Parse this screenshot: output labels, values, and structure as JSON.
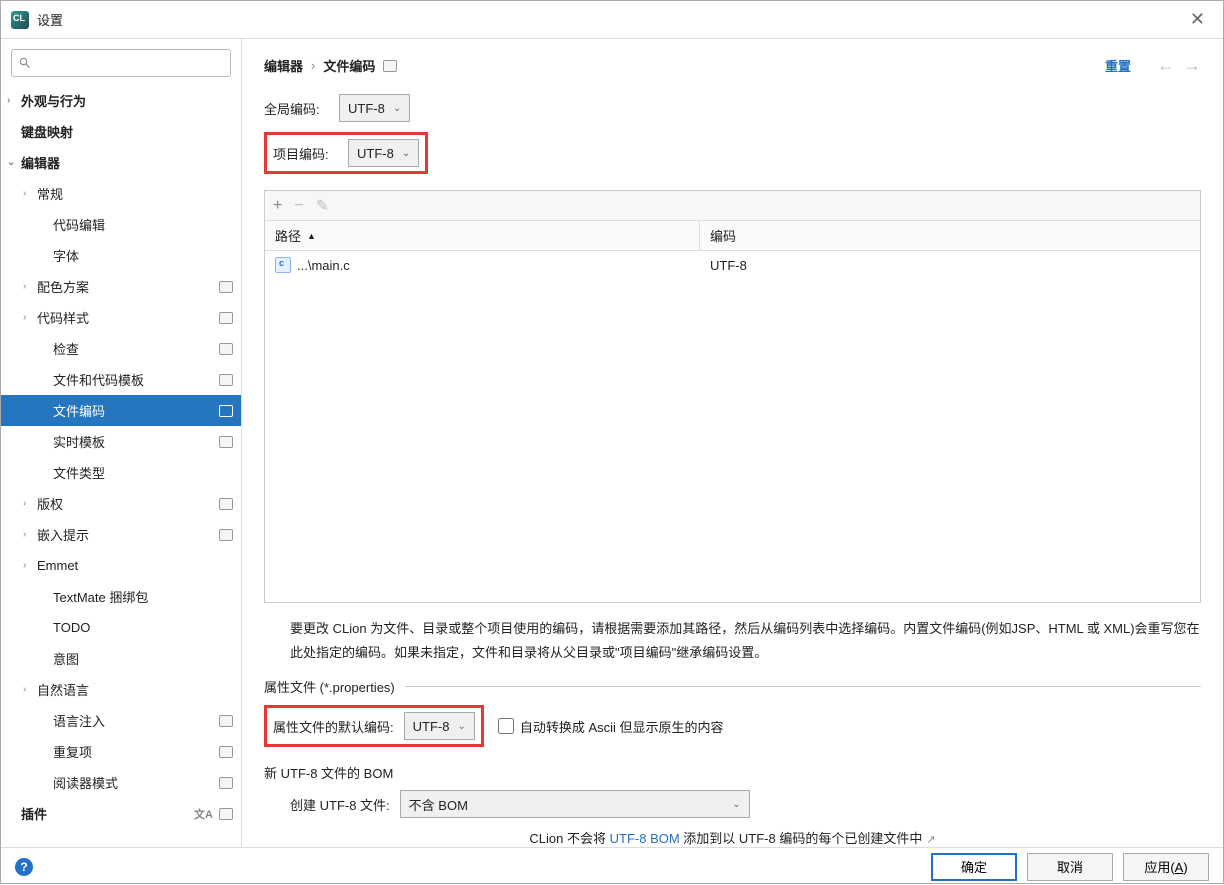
{
  "window": {
    "title": "设置"
  },
  "sidebar": {
    "search_placeholder": "",
    "items": [
      {
        "label": "外观与行为",
        "level": 0,
        "chev": "›",
        "bold": true
      },
      {
        "label": "键盘映射",
        "level": 0,
        "bold": true
      },
      {
        "label": "编辑器",
        "level": 0,
        "chev": "⌄",
        "bold": true
      },
      {
        "label": "常规",
        "level": 1,
        "chev": "›"
      },
      {
        "label": "代码编辑",
        "level": 2
      },
      {
        "label": "字体",
        "level": 2
      },
      {
        "label": "配色方案",
        "level": 1,
        "chev": "›",
        "badge": true
      },
      {
        "label": "代码样式",
        "level": 1,
        "chev": "›",
        "badge": true
      },
      {
        "label": "检查",
        "level": 2,
        "badge": true
      },
      {
        "label": "文件和代码模板",
        "level": 2,
        "badge": true
      },
      {
        "label": "文件编码",
        "level": 2,
        "badge": true,
        "selected": true
      },
      {
        "label": "实时模板",
        "level": 2,
        "badge": true
      },
      {
        "label": "文件类型",
        "level": 2
      },
      {
        "label": "版权",
        "level": 1,
        "chev": "›",
        "badge": true
      },
      {
        "label": "嵌入提示",
        "level": 1,
        "chev": "›",
        "badge": true
      },
      {
        "label": "Emmet",
        "level": 1,
        "chev": "›"
      },
      {
        "label": "TextMate 捆绑包",
        "level": 2
      },
      {
        "label": "TODO",
        "level": 2
      },
      {
        "label": "意图",
        "level": 2
      },
      {
        "label": "自然语言",
        "level": 1,
        "chev": "›"
      },
      {
        "label": "语言注入",
        "level": 2,
        "badge": true
      },
      {
        "label": "重复项",
        "level": 2,
        "badge": true
      },
      {
        "label": "阅读器模式",
        "level": 2,
        "badge": true
      },
      {
        "label": "插件",
        "level": 0,
        "bold": true,
        "lang": true,
        "badge": true
      }
    ]
  },
  "breadcrumb": {
    "root": "编辑器",
    "page": "文件编码",
    "reset": "重置"
  },
  "encoding": {
    "global_label": "全局编码:",
    "global_value": "UTF-8",
    "project_label": "项目编码:",
    "project_value": "UTF-8"
  },
  "table": {
    "col_path": "路径",
    "col_encoding": "编码",
    "rows": [
      {
        "path": "...\\main.c",
        "encoding": "UTF-8"
      }
    ]
  },
  "help_text": "要更改 CLion 为文件、目录或整个项目使用的编码，请根据需要添加其路径，然后从编码列表中选择编码。内置文件编码(例如JSP、HTML 或 XML)会重写您在此处指定的编码。如果未指定，文件和目录将从父目录或\"项目编码\"继承编码设置。",
  "properties": {
    "legend": "属性文件 (*.properties)",
    "default_label": "属性文件的默认编码:",
    "default_value": "UTF-8",
    "ascii_checkbox": "自动转换成 Ascii 但显示原生的内容"
  },
  "bom": {
    "heading": "新 UTF-8 文件的 BOM",
    "create_label": "创建 UTF-8 文件:",
    "create_value": "不含 BOM",
    "note_prefix": "CLion 不会将 ",
    "note_link": "UTF-8 BOM",
    "note_suffix": " 添加到以 UTF-8 编码的每个已创建文件中"
  },
  "footer": {
    "ok": "确定",
    "cancel": "取消",
    "apply": "应用(",
    "apply_mnemonic": "A",
    "apply_suffix": ")"
  }
}
